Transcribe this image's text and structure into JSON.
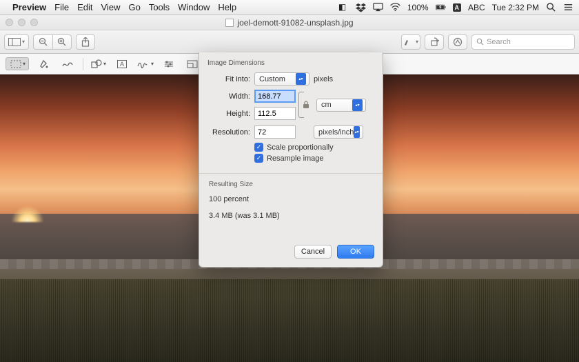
{
  "menubar": {
    "app": "Preview",
    "items": [
      "File",
      "Edit",
      "View",
      "Go",
      "Tools",
      "Window",
      "Help"
    ],
    "status": {
      "battery": "100%",
      "input": "ABC",
      "clock": "Tue 2:32 PM"
    }
  },
  "window": {
    "title": "joel-demott-91082-unsplash.jpg",
    "search_placeholder": "Search"
  },
  "dialog": {
    "section_image": "Image Dimensions",
    "fit_label": "Fit into:",
    "fit_value": "Custom",
    "fit_unit": "pixels",
    "width_label": "Width:",
    "width_value": "168.77",
    "height_label": "Height:",
    "height_value": "112.5",
    "dim_unit": "cm",
    "res_label": "Resolution:",
    "res_value": "72",
    "res_unit": "pixels/inch",
    "cb_scale": "Scale proportionally",
    "cb_resample": "Resample image",
    "section_result": "Resulting Size",
    "result_percent": "100 percent",
    "result_size": "3.4 MB (was 3.1 MB)",
    "cancel": "Cancel",
    "ok": "OK"
  }
}
